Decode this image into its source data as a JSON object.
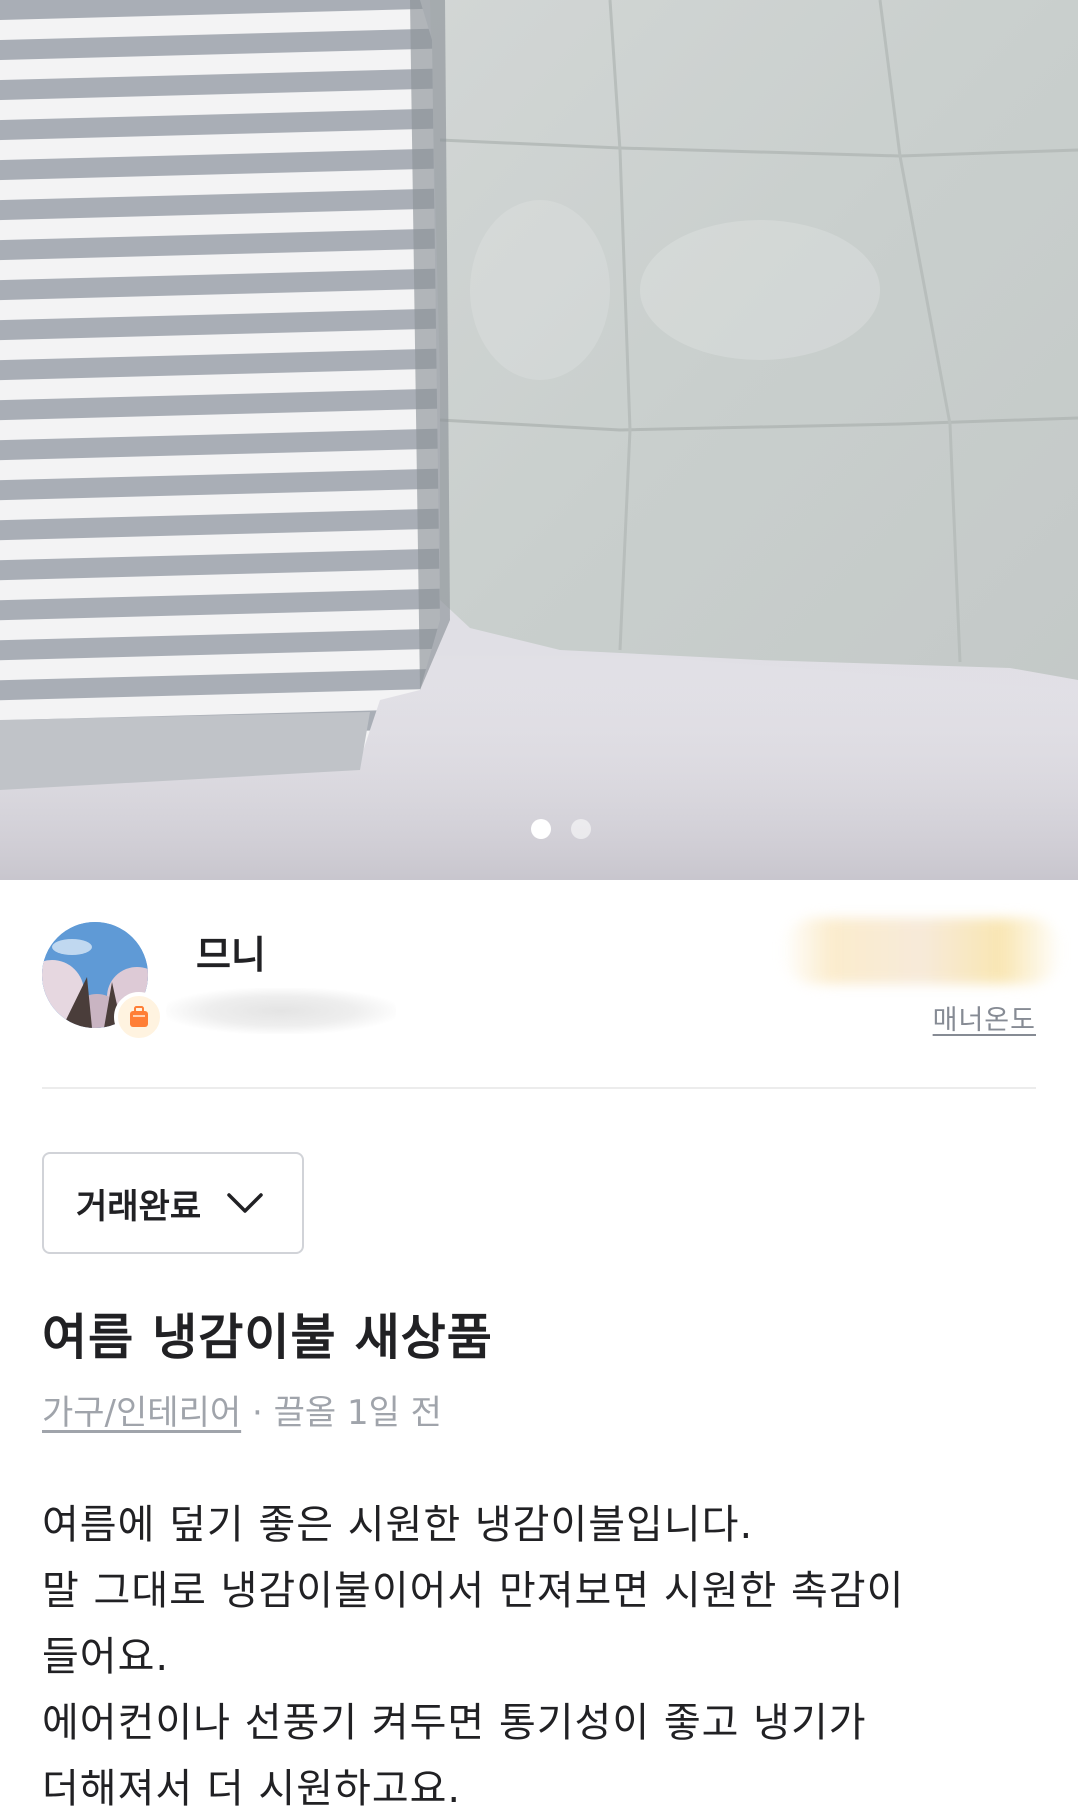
{
  "carousel": {
    "image_description_icon": "photo-cooling-blankets",
    "page_count": 2,
    "active_index": 0
  },
  "seller": {
    "nickname": "므니",
    "manner_label": "매너온도",
    "badge_icon": "suitcase-icon"
  },
  "status": {
    "selected": "거래완료",
    "icon": "chevron-down-icon"
  },
  "listing": {
    "title": "여름 냉감이불 새상품",
    "category": "가구/인테리어",
    "separator": " · ",
    "time": "끌올 1일 전",
    "description_lines": [
      "여름에 덮기 좋은 시원한 냉감이불입니다.",
      "말 그대로 냉감이불이어서 만져보면 시원한 촉감이",
      "들어요.",
      "에어컨이나 선풍기 켜두면 통기성이 좋고 냉기가",
      "더해져서 더 시원하고요."
    ]
  },
  "colors": {
    "accent": "#ff6f0f",
    "text": "#212124",
    "muted": "#a0a4ab"
  }
}
